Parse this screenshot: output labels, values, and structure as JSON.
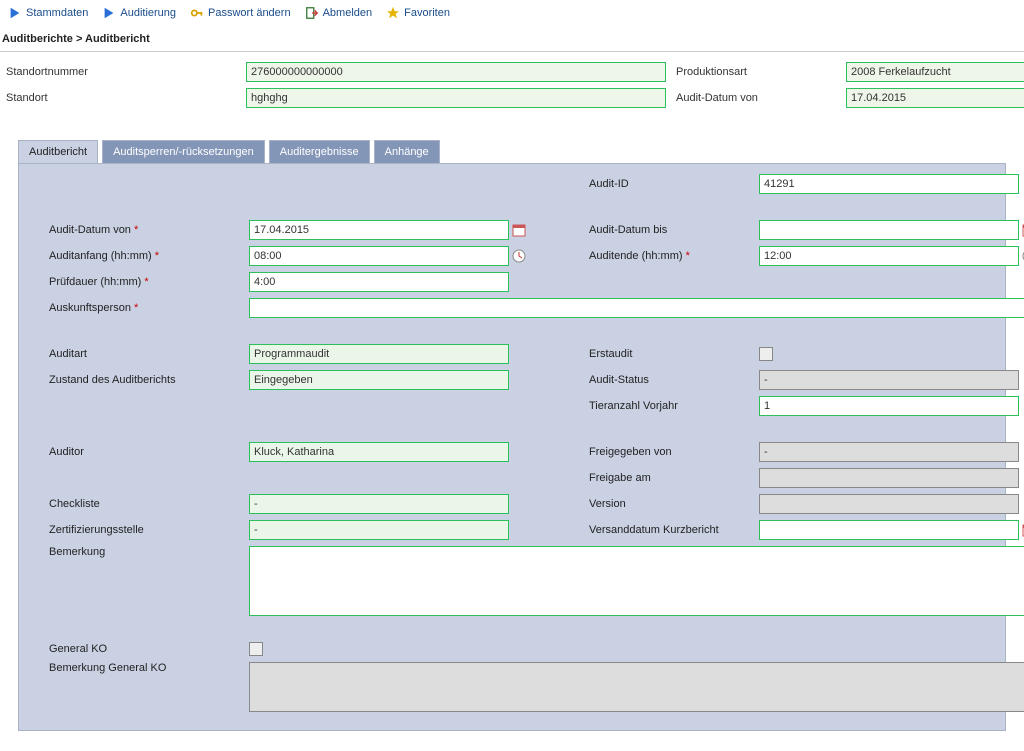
{
  "nav": {
    "stammdaten": "Stammdaten",
    "auditierung": "Auditierung",
    "passwort": "Passwort ändern",
    "abmelden": "Abmelden",
    "favoriten": "Favoriten"
  },
  "breadcrumb": "Auditberichte > Auditbericht",
  "header": {
    "standortnummer_label": "Standortnummer",
    "standortnummer": "276000000000000",
    "standort_label": "Standort",
    "standort": "hghghg",
    "produktionsart_label": "Produktionsart",
    "produktionsart": "2008 Ferkelaufzucht",
    "audit_datum_von_label": "Audit-Datum von",
    "audit_datum_von": "17.04.2015"
  },
  "tabs": {
    "t1": "Auditbericht",
    "t2": "Auditsperren/-rücksetzungen",
    "t3": "Auditergebnisse",
    "t4": "Anhänge"
  },
  "form": {
    "audit_id_label": "Audit-ID",
    "audit_id": "41291",
    "audit_datum_von_label": "Audit-Datum von",
    "audit_datum_von": "17.04.2015",
    "audit_datum_bis_label": "Audit-Datum bis",
    "audit_datum_bis": "",
    "auditanfang_label": "Auditanfang (hh:mm)",
    "auditanfang": "08:00",
    "auditende_label": "Auditende (hh:mm)",
    "auditende": "12:00",
    "pruefdauer_label": "Prüfdauer (hh:mm)",
    "pruefdauer": "4:00",
    "auskunftsperson_label": "Auskunftsperson",
    "auskunftsperson": "",
    "auditart_label": "Auditart",
    "auditart": "Programmaudit",
    "erstaudit_label": "Erstaudit",
    "zustand_label": "Zustand des Auditberichts",
    "zustand": "Eingegeben",
    "audit_status_label": "Audit-Status",
    "audit_status": "-",
    "tieranzahl_label": "Tieranzahl Vorjahr",
    "tieranzahl": "1",
    "auditor_label": "Auditor",
    "auditor": "Kluck, Katharina",
    "freigegeben_von_label": "Freigegeben von",
    "freigegeben_von": "-",
    "freigabe_am_label": "Freigabe am",
    "freigabe_am": "",
    "checkliste_label": "Checkliste",
    "checkliste": "-",
    "version_label": "Version",
    "version": "",
    "zertstelle_label": "Zertifizierungsstelle",
    "zertstelle": "-",
    "versanddatum_label": "Versanddatum Kurzbericht",
    "versanddatum": "",
    "bemerkung_label": "Bemerkung",
    "bemerkung": "",
    "general_ko_label": "General KO",
    "bemerkung_ko_label": "Bemerkung General KO",
    "bemerkung_ko": ""
  }
}
